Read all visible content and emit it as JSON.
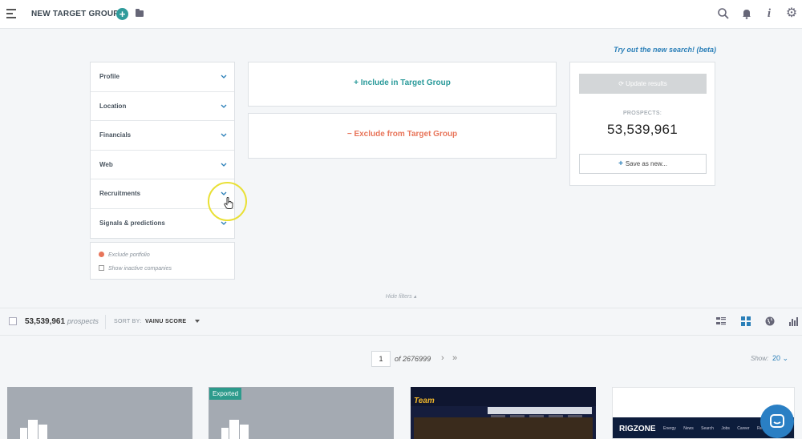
{
  "header": {
    "title": "NEW TARGET GROUP",
    "add_label": "+"
  },
  "beta_link": "Try out the new search! (beta)",
  "filters": [
    {
      "label": "Profile"
    },
    {
      "label": "Location"
    },
    {
      "label": "Financials"
    },
    {
      "label": "Web"
    },
    {
      "label": "Recruitments"
    },
    {
      "label": "Signals & predictions"
    }
  ],
  "filter_options": {
    "exclude_portfolio": "Exclude portfolio",
    "show_inactive": "Show inactive companies"
  },
  "target_group": {
    "include_label": "+ Include in Target Group",
    "exclude_label": "− Exclude from Target Group"
  },
  "prospects_panel": {
    "update_label": "⟳ Update results",
    "prospects_label": "PROSPECTS:",
    "prospects_count": "53,539,961",
    "save_label": "Save as new..."
  },
  "hide_filters": "Hide filters ▴",
  "results": {
    "count": "53,539,961",
    "count_word": "prospects",
    "sort_by_label": "SORT BY:",
    "sort_by_value": "VAINU SCORE"
  },
  "pagination": {
    "current_page": "1",
    "of_label": "of",
    "total_pages": "2676999",
    "next": "›",
    "last": "»",
    "show_label": "Show:",
    "show_value": "20 ⌄"
  },
  "cards": [
    {
      "badge": ""
    },
    {
      "badge": "Exported"
    },
    {
      "logo_text": "Team"
    },
    {
      "logo_text": "RIGZONE",
      "nav_text": "Energy News Search Jobs Career Resources Eve"
    }
  ],
  "colors": {
    "accent": "#2a9a9a",
    "exclude": "#e8755a",
    "link": "#2a7fb8",
    "chat": "#2a7fc4"
  },
  "icons": [
    "menu-icon",
    "folder-icon",
    "search-icon",
    "bell-icon",
    "info-icon",
    "gear-icon",
    "chevron-down-icon",
    "hand-cursor-icon",
    "list-view-icon",
    "grid-view-icon",
    "globe-icon",
    "bar-chart-icon",
    "chat-icon",
    "building-icon"
  ]
}
